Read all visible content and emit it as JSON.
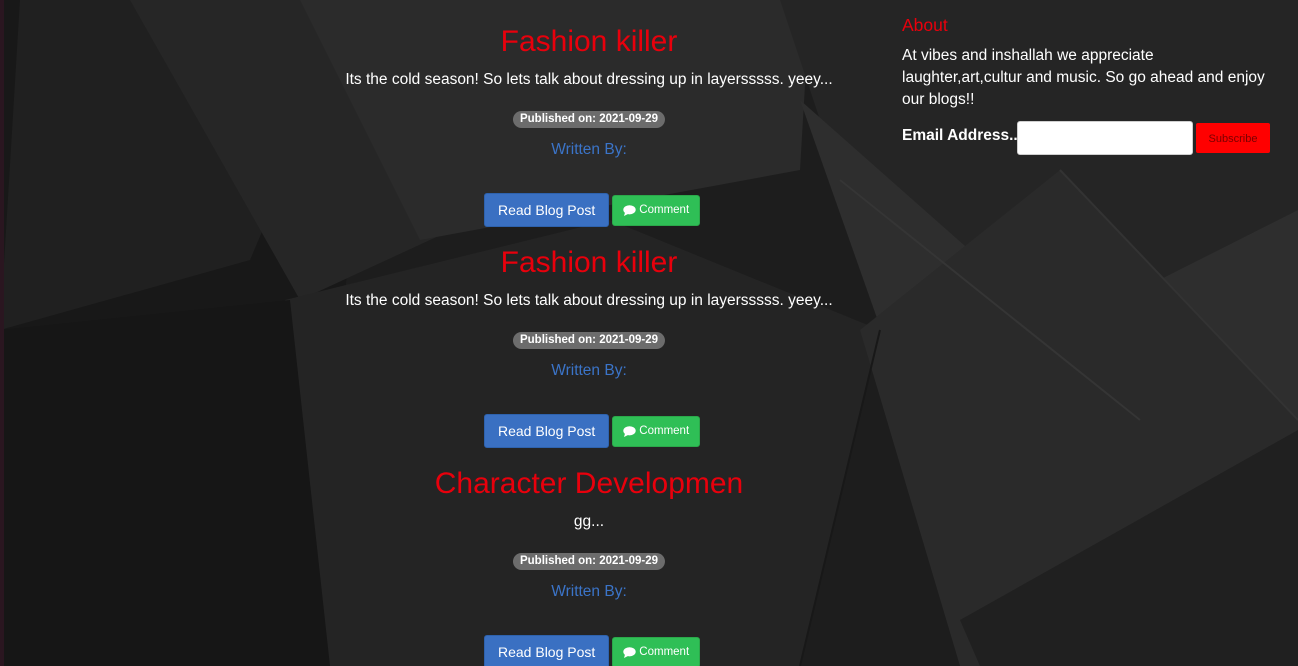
{
  "posts": [
    {
      "title": "Fashion killer",
      "excerpt": "Its the cold season! So lets talk about dressing up in layersssss. yeey...",
      "published": "Published on: 2021-09-29",
      "written_by": "Written By:",
      "read_label": "Read Blog Post",
      "comment_label": "Comment"
    },
    {
      "title": "Fashion killer",
      "excerpt": "Its the cold season! So lets talk about dressing up in layersssss. yeey...",
      "published": "Published on: 2021-09-29",
      "written_by": "Written By:",
      "read_label": "Read Blog Post",
      "comment_label": "Comment"
    },
    {
      "title": "Character Developmen",
      "excerpt": "gg...",
      "published": "Published on: 2021-09-29",
      "written_by": "Written By:",
      "read_label": "Read Blog Post",
      "comment_label": "Comment"
    }
  ],
  "sidebar": {
    "about_title": "About",
    "about_text": "At vibes and inshallah we appreciate laughter,art,cultur and music. So go ahead and enjoy our blogs!!",
    "email_label": "Email Address...",
    "email_value": "",
    "email_placeholder": "",
    "subscribe_label": "Subscribe"
  },
  "icons": {
    "comment": "comment-bubble-icon"
  },
  "colors": {
    "title_red": "#e8000c",
    "author_blue": "#3b74c8",
    "read_button": "#3a70c2",
    "comment_button": "#2fbf56",
    "subscribe_button": "#ff0000",
    "badge_gray": "#6c6c6c",
    "background": "#1f1f1f"
  }
}
